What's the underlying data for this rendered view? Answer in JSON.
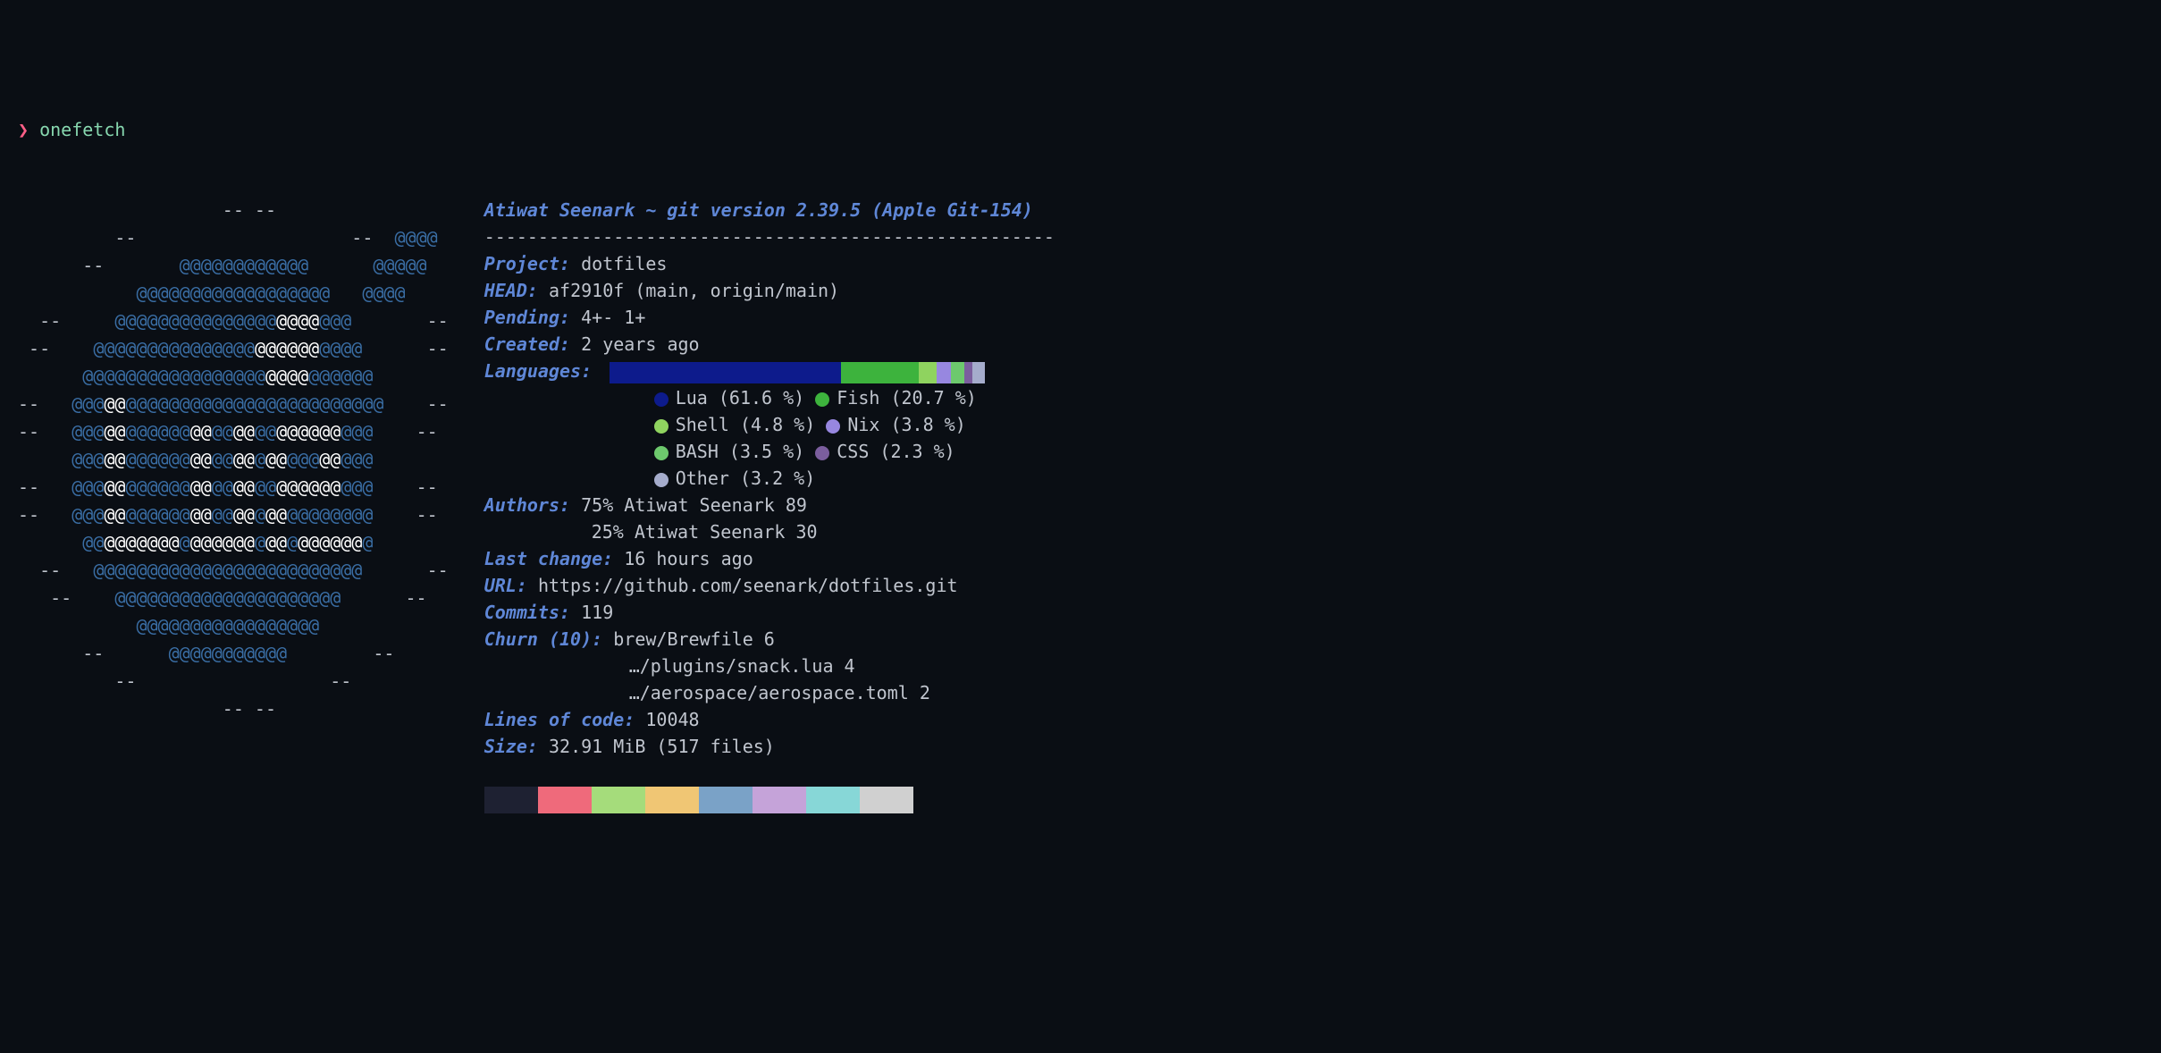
{
  "prompt": {
    "symbol": "❯",
    "command": "onefetch"
  },
  "ascii": [
    [
      {
        "t": "                   ",
        "c": "d"
      },
      {
        "t": "-- --",
        "c": "d"
      }
    ],
    [
      {
        "t": "         ",
        "c": "d"
      },
      {
        "t": "--",
        "c": "d"
      },
      {
        "t": "                    ",
        "c": "d"
      },
      {
        "t": "--",
        "c": "d"
      },
      {
        "t": "  ",
        "c": "d"
      },
      {
        "t": "@@@@",
        "c": "b"
      }
    ],
    [
      {
        "t": "      ",
        "c": "d"
      },
      {
        "t": "--",
        "c": "d"
      },
      {
        "t": "       ",
        "c": "d"
      },
      {
        "t": "@@@@@@@@@@@@",
        "c": "b"
      },
      {
        "t": "      ",
        "c": "d"
      },
      {
        "t": "@@@@@",
        "c": "b"
      }
    ],
    [
      {
        "t": "           ",
        "c": "d"
      },
      {
        "t": "@@@@@@@@@@@@@@@@@@",
        "c": "b"
      },
      {
        "t": "   ",
        "c": "d"
      },
      {
        "t": "@@@@",
        "c": "b"
      }
    ],
    [
      {
        "t": "  ",
        "c": "d"
      },
      {
        "t": "--",
        "c": "d"
      },
      {
        "t": "     ",
        "c": "d"
      },
      {
        "t": "@@@@@@@@@@@@@@@",
        "c": "b"
      },
      {
        "t": "@@@@",
        "c": "w"
      },
      {
        "t": "@@@",
        "c": "b"
      },
      {
        "t": "       ",
        "c": "d"
      },
      {
        "t": "--",
        "c": "d"
      }
    ],
    [
      {
        "t": " ",
        "c": "d"
      },
      {
        "t": "--",
        "c": "d"
      },
      {
        "t": "    ",
        "c": "d"
      },
      {
        "t": "@@@@@@@@@@@@@@@",
        "c": "b"
      },
      {
        "t": "@@@@@@",
        "c": "w"
      },
      {
        "t": "@@@@",
        "c": "b"
      },
      {
        "t": "      ",
        "c": "d"
      },
      {
        "t": "--",
        "c": "d"
      }
    ],
    [
      {
        "t": "      ",
        "c": "d"
      },
      {
        "t": "@@@@@@@@@@@@@@@@@",
        "c": "b"
      },
      {
        "t": "@@@@",
        "c": "w"
      },
      {
        "t": "@@@@@@",
        "c": "b"
      }
    ],
    [
      {
        "t": "--",
        "c": "d"
      },
      {
        "t": "   ",
        "c": "d"
      },
      {
        "t": "@@@",
        "c": "b"
      },
      {
        "t": "@@",
        "c": "w"
      },
      {
        "t": "@@@@@@@@@@@@@@@@@@@@@@@@",
        "c": "b"
      },
      {
        "t": "    ",
        "c": "d"
      },
      {
        "t": "--",
        "c": "d"
      }
    ],
    [
      {
        "t": "--",
        "c": "d"
      },
      {
        "t": "   ",
        "c": "d"
      },
      {
        "t": "@@@",
        "c": "b"
      },
      {
        "t": "@@",
        "c": "w"
      },
      {
        "t": "@@@@@@",
        "c": "b"
      },
      {
        "t": "@@",
        "c": "w"
      },
      {
        "t": "@@",
        "c": "b"
      },
      {
        "t": "@@",
        "c": "w"
      },
      {
        "t": "@@",
        "c": "b"
      },
      {
        "t": "@@@@@@",
        "c": "w"
      },
      {
        "t": "@@@",
        "c": "b"
      },
      {
        "t": "    ",
        "c": "d"
      },
      {
        "t": "--",
        "c": "d"
      }
    ],
    [
      {
        "t": "     ",
        "c": "d"
      },
      {
        "t": "@@@",
        "c": "b"
      },
      {
        "t": "@@",
        "c": "w"
      },
      {
        "t": "@@@@@@",
        "c": "b"
      },
      {
        "t": "@@",
        "c": "w"
      },
      {
        "t": "@@",
        "c": "b"
      },
      {
        "t": "@@",
        "c": "w"
      },
      {
        "t": "@",
        "c": "b"
      },
      {
        "t": "@@",
        "c": "w"
      },
      {
        "t": "@@@",
        "c": "b"
      },
      {
        "t": "@@",
        "c": "w"
      },
      {
        "t": "@@@",
        "c": "b"
      }
    ],
    [
      {
        "t": "--",
        "c": "d"
      },
      {
        "t": "   ",
        "c": "d"
      },
      {
        "t": "@@@",
        "c": "b"
      },
      {
        "t": "@@",
        "c": "w"
      },
      {
        "t": "@@@@@@",
        "c": "b"
      },
      {
        "t": "@@",
        "c": "w"
      },
      {
        "t": "@@",
        "c": "b"
      },
      {
        "t": "@@",
        "c": "w"
      },
      {
        "t": "@@",
        "c": "b"
      },
      {
        "t": "@@@@@@",
        "c": "w"
      },
      {
        "t": "@@@",
        "c": "b"
      },
      {
        "t": "    ",
        "c": "d"
      },
      {
        "t": "--",
        "c": "d"
      }
    ],
    [
      {
        "t": "--",
        "c": "d"
      },
      {
        "t": "   ",
        "c": "d"
      },
      {
        "t": "@@@",
        "c": "b"
      },
      {
        "t": "@@",
        "c": "w"
      },
      {
        "t": "@@@@@@",
        "c": "b"
      },
      {
        "t": "@@",
        "c": "w"
      },
      {
        "t": "@@",
        "c": "b"
      },
      {
        "t": "@@",
        "c": "w"
      },
      {
        "t": "@",
        "c": "b"
      },
      {
        "t": "@@",
        "c": "w"
      },
      {
        "t": "@@@@@@@@",
        "c": "b"
      },
      {
        "t": "    ",
        "c": "d"
      },
      {
        "t": "--",
        "c": "d"
      }
    ],
    [
      {
        "t": "      ",
        "c": "d"
      },
      {
        "t": "@@",
        "c": "b"
      },
      {
        "t": "@@@@@@@",
        "c": "w"
      },
      {
        "t": "@",
        "c": "b"
      },
      {
        "t": "@@@@@@",
        "c": "w"
      },
      {
        "t": "@",
        "c": "b"
      },
      {
        "t": "@@",
        "c": "w"
      },
      {
        "t": "@",
        "c": "b"
      },
      {
        "t": "@@@@@@",
        "c": "w"
      },
      {
        "t": "@",
        "c": "b"
      }
    ],
    [
      {
        "t": "  ",
        "c": "d"
      },
      {
        "t": "--",
        "c": "d"
      },
      {
        "t": "   ",
        "c": "d"
      },
      {
        "t": "@@@@@@@@@@@@@@@@@@@@@@@@@",
        "c": "b"
      },
      {
        "t": "      ",
        "c": "d"
      },
      {
        "t": "--",
        "c": "d"
      }
    ],
    [
      {
        "t": "   ",
        "c": "d"
      },
      {
        "t": "--",
        "c": "d"
      },
      {
        "t": "    ",
        "c": "d"
      },
      {
        "t": "@@@@@@@@@@@@@@@@@@@@@",
        "c": "b"
      },
      {
        "t": "      ",
        "c": "d"
      },
      {
        "t": "--",
        "c": "d"
      }
    ],
    [
      {
        "t": "           ",
        "c": "d"
      },
      {
        "t": "@@@@@@@@@@@@@@@@@",
        "c": "b"
      }
    ],
    [
      {
        "t": "      ",
        "c": "d"
      },
      {
        "t": "--",
        "c": "d"
      },
      {
        "t": "      ",
        "c": "d"
      },
      {
        "t": "@@@@@@@@@@@",
        "c": "b"
      },
      {
        "t": "        ",
        "c": "d"
      },
      {
        "t": "--",
        "c": "d"
      }
    ],
    [
      {
        "t": "         ",
        "c": "d"
      },
      {
        "t": "--",
        "c": "d"
      },
      {
        "t": "                  ",
        "c": "d"
      },
      {
        "t": "--",
        "c": "d"
      }
    ],
    [
      {
        "t": "                   ",
        "c": "d"
      },
      {
        "t": "-- --",
        "c": "d"
      }
    ]
  ],
  "header": "Atiwat Seenark ~ git version 2.39.5 (Apple Git-154)",
  "separator": "-----------------------------------------------------",
  "info": {
    "project": {
      "label": "Project",
      "value": "dotfiles"
    },
    "head": {
      "label": "HEAD",
      "value": "af2910f (main, origin/main)"
    },
    "pending": {
      "label": "Pending",
      "value": "4+- 1+"
    },
    "created": {
      "label": "Created",
      "value": "2 years ago"
    },
    "languages": {
      "label": "Languages",
      "bar": [
        {
          "color": "#0d1b8c",
          "pct": 61.6
        },
        {
          "color": "#3db33d",
          "pct": 20.7
        },
        {
          "color": "#8fd35f",
          "pct": 4.8
        },
        {
          "color": "#9787e0",
          "pct": 3.8
        },
        {
          "color": "#6dc96d",
          "pct": 3.5
        },
        {
          "color": "#7b5e9e",
          "pct": 2.3
        },
        {
          "color": "#a5accc",
          "pct": 3.2
        }
      ],
      "items": [
        {
          "color": "#0d1b8c",
          "name": "Lua",
          "pct": "61.6 %"
        },
        {
          "color": "#3db33d",
          "name": "Fish",
          "pct": "20.7 %"
        },
        {
          "color": "#8fd35f",
          "name": "Shell",
          "pct": "4.8 %"
        },
        {
          "color": "#9787e0",
          "name": "Nix",
          "pct": "3.8 %"
        },
        {
          "color": "#6dc96d",
          "name": "BASH",
          "pct": "3.5 %"
        },
        {
          "color": "#7b5e9e",
          "name": "CSS",
          "pct": "2.3 %"
        },
        {
          "color": "#a5accc",
          "name": "Other",
          "pct": "3.2 %"
        }
      ]
    },
    "authors": {
      "label": "Authors",
      "lines": [
        "75% Atiwat Seenark 89",
        "25% Atiwat Seenark 30"
      ]
    },
    "lastchange": {
      "label": "Last change",
      "value": "16 hours ago"
    },
    "url": {
      "label": "URL",
      "value": "https://github.com/seenark/dotfiles.git"
    },
    "commits": {
      "label": "Commits",
      "value": "119"
    },
    "churn": {
      "label": "Churn (10)",
      "lines": [
        "brew/Brewfile 6",
        "…/plugins/snack.lua 4",
        "…/aerospace/aerospace.toml 2"
      ]
    },
    "loc": {
      "label": "Lines of code",
      "value": "10048"
    },
    "size": {
      "label": "Size",
      "value": "32.91 MiB (517 files)"
    }
  },
  "palette": [
    "#1e2132",
    "#ef6a7b",
    "#a5dc7b",
    "#f0c674",
    "#7aa2c7",
    "#c5a3d9",
    "#87d7d7",
    "#d0d0d0"
  ]
}
